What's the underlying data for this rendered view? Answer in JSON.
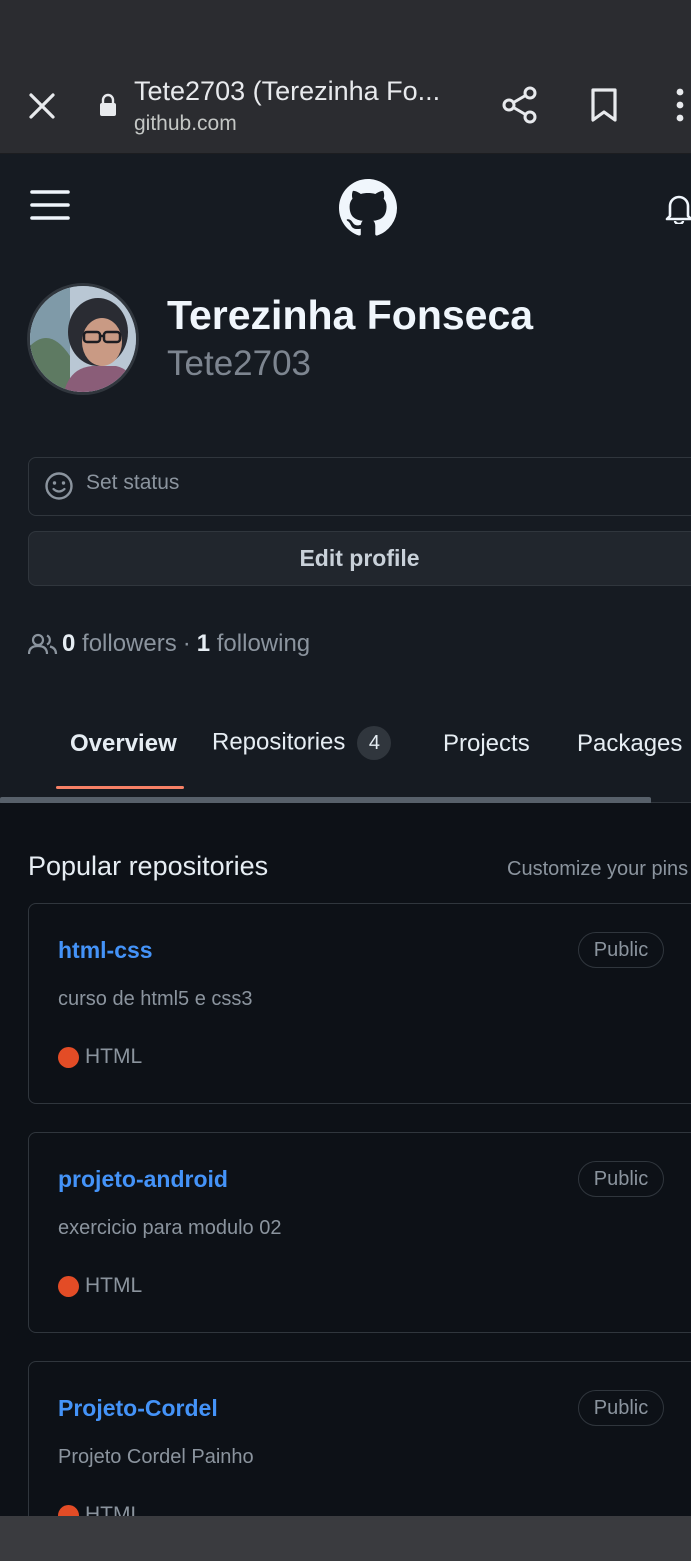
{
  "browser": {
    "title": "Tete2703 (Terezinha Fo...",
    "url": "github.com"
  },
  "profile": {
    "full_name": "Terezinha Fonseca",
    "login": "Tete2703",
    "set_status": "Set status",
    "edit_profile": "Edit profile",
    "followers_count": "0",
    "followers_label": "followers",
    "separator": "·",
    "following_count": "1",
    "following_label": "following"
  },
  "tabs": [
    {
      "label": "Overview",
      "active": true
    },
    {
      "label": "Repositories",
      "count": "4"
    },
    {
      "label": "Projects"
    },
    {
      "label": "Packages"
    }
  ],
  "popular": {
    "title": "Popular repositories",
    "customize": "Customize your pins",
    "repos": [
      {
        "name": "html-css",
        "visibility": "Public",
        "description": "curso de html5 e css3",
        "language": "HTML",
        "language_color": "#e34c26"
      },
      {
        "name": "projeto-android",
        "visibility": "Public",
        "description": "exercicio para modulo 02",
        "language": "HTML",
        "language_color": "#e34c26"
      },
      {
        "name": "Projeto-Cordel",
        "visibility": "Public",
        "description": "Projeto Cordel Painho",
        "language": "HTML",
        "language_color": "#e34c26"
      }
    ]
  },
  "colors": {
    "background": "#161b22",
    "accent_link": "#4493f8",
    "tab_underline": "#f78166"
  }
}
